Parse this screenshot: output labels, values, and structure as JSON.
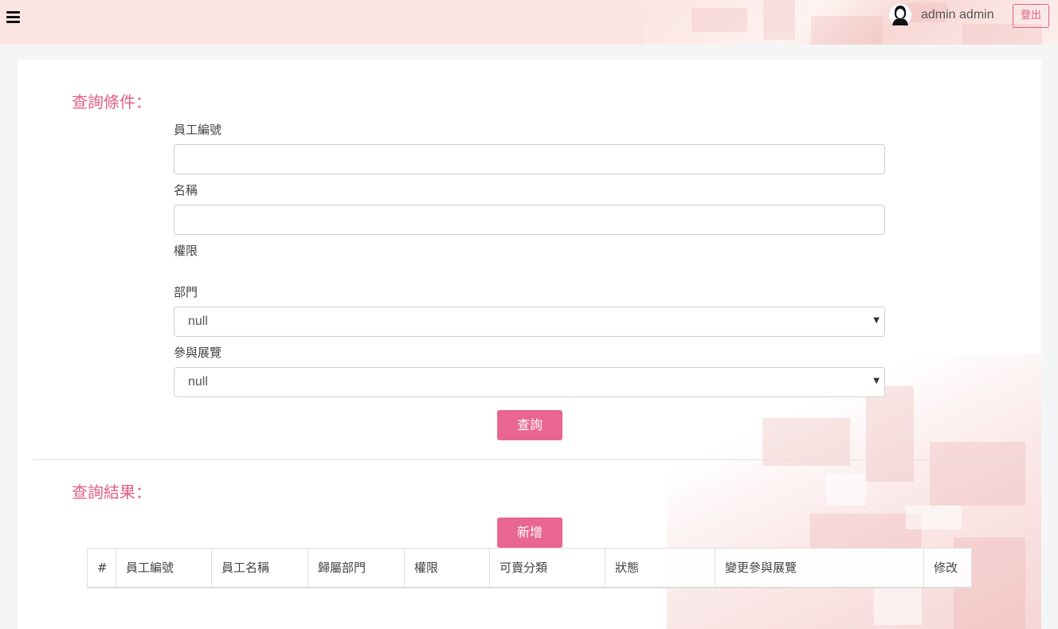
{
  "header": {
    "username": "admin admin",
    "logout_label": "登出",
    "menu_icon": "hamburger-menu-icon",
    "avatar_icon": "user-avatar-icon"
  },
  "query": {
    "title": "查詢條件：",
    "employee_id_label": "員工編號",
    "employee_id_value": "",
    "name_label": "名稱",
    "name_value": "",
    "permission_label": "權限",
    "department_label": "部門",
    "department_selected": "null",
    "exhibition_label": "參與展覽",
    "exhibition_selected": "null",
    "search_button": "查詢"
  },
  "results": {
    "title": "查詢結果：",
    "add_button": "新增",
    "columns": [
      "#",
      "員工編號",
      "員工名稱",
      "歸屬部門",
      "權限",
      "可賣分類",
      "狀態",
      "變更參與展覽",
      "修改"
    ],
    "rows": []
  },
  "colors": {
    "accent": "#e8668f",
    "header_bg": "#fbe5e0"
  }
}
